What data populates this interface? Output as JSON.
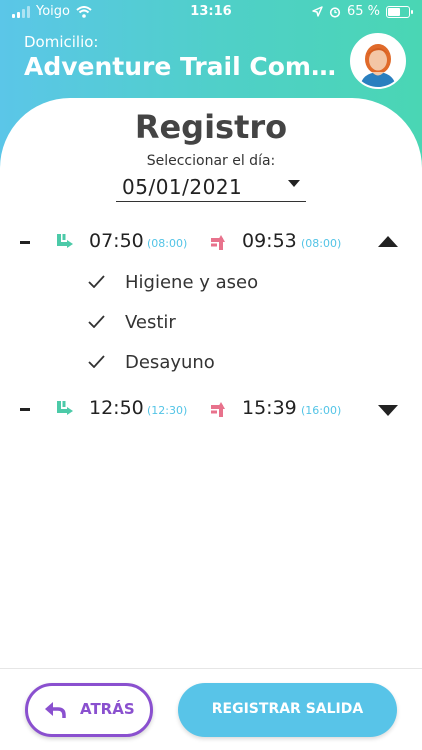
{
  "status_bar": {
    "carrier": "Yoigo",
    "time": "13:16",
    "battery": "65 %",
    "battery_level": 0.65
  },
  "header": {
    "domicilio_label": "Domicilio:",
    "domicilio_name": "Adventure Trail Com..."
  },
  "page": {
    "title": "Registro",
    "date_label": "Seleccionar el día:",
    "date_value": "05/01/2021"
  },
  "shifts": [
    {
      "check_in": "07:50",
      "check_in_scheduled": "(08:00)",
      "check_out": "09:53",
      "check_out_scheduled": "(08:00)",
      "expanded": true,
      "tasks": [
        "Higiene y aseo",
        "Vestir",
        "Desayuno"
      ]
    },
    {
      "check_in": "12:50",
      "check_in_scheduled": "(12:30)",
      "check_out": "15:39",
      "check_out_scheduled": "(16:00)",
      "expanded": false,
      "tasks": []
    }
  ],
  "footer": {
    "back_label": "ATRÁS",
    "register_label": "REGISTRAR SALIDA"
  },
  "colors": {
    "header_gradient_start": "#5bc6e8",
    "header_gradient_end": "#4ad6b4",
    "check_in_icon": "#4ccaa8",
    "check_out_icon": "#e8728c",
    "scheduled_text": "#53c4e6",
    "back_button": "#8a50cf",
    "register_button": "#58c4e8"
  },
  "icons": {
    "check_in": "arrow-turn-down-right-icon",
    "check_out": "arrow-turn-up-right-icon",
    "task": "check-icon",
    "back": "reply-arrow-icon"
  }
}
